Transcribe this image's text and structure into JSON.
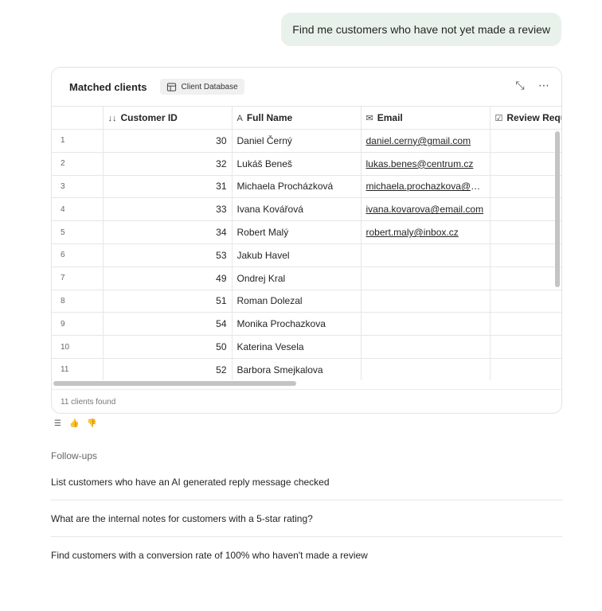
{
  "user_message": "Find me customers who have not yet made a review",
  "card": {
    "title": "Matched clients",
    "source_label": "Client Database",
    "footer_text": "11 clients found"
  },
  "columns": [
    {
      "label": "",
      "icon": ""
    },
    {
      "label": "Customer ID",
      "icon": "sort-numeric-icon"
    },
    {
      "label": "Full Name",
      "icon": "text-type-icon"
    },
    {
      "label": "Email",
      "icon": "mail-icon"
    },
    {
      "label": "Review Requ",
      "icon": "checkbox-icon"
    }
  ],
  "rows": [
    {
      "n": "1",
      "id": "30",
      "name": "Daniel Černý",
      "email": "daniel.cerny@gmail.com",
      "review": true
    },
    {
      "n": "2",
      "id": "32",
      "name": "Lukáš Beneš",
      "email": "lukas.benes@centrum.cz",
      "review": false
    },
    {
      "n": "3",
      "id": "31",
      "name": "Michaela Procházková",
      "email": "michaela.prochazkova@sez...",
      "review": true
    },
    {
      "n": "4",
      "id": "33",
      "name": "Ivana Kovářová",
      "email": "ivana.kovarova@email.com",
      "review": false
    },
    {
      "n": "5",
      "id": "34",
      "name": "Robert Malý",
      "email": "robert.maly@inbox.cz",
      "review": false
    },
    {
      "n": "6",
      "id": "53",
      "name": "Jakub Havel",
      "email": "",
      "review": true
    },
    {
      "n": "7",
      "id": "49",
      "name": "Ondrej Kral",
      "email": "",
      "review": true
    },
    {
      "n": "8",
      "id": "51",
      "name": "Roman Dolezal",
      "email": "",
      "review": true
    },
    {
      "n": "9",
      "id": "54",
      "name": "Monika Prochazkova",
      "email": "",
      "review": true
    },
    {
      "n": "10",
      "id": "50",
      "name": "Katerina Vesela",
      "email": "",
      "review": true
    },
    {
      "n": "11",
      "id": "52",
      "name": "Barbora Smejkalova",
      "email": "",
      "review": true
    }
  ],
  "check_glyph": "✓",
  "followups": {
    "title": "Follow-ups",
    "items": [
      "List customers who have an AI generated reply message checked",
      "What are the internal notes for customers with a 5-star rating?",
      "Find customers with a conversion rate of 100% who haven't made a review"
    ]
  },
  "colors": {
    "user_bubble_bg": "#e9f2ea",
    "check_green": "#1a8a1a"
  }
}
